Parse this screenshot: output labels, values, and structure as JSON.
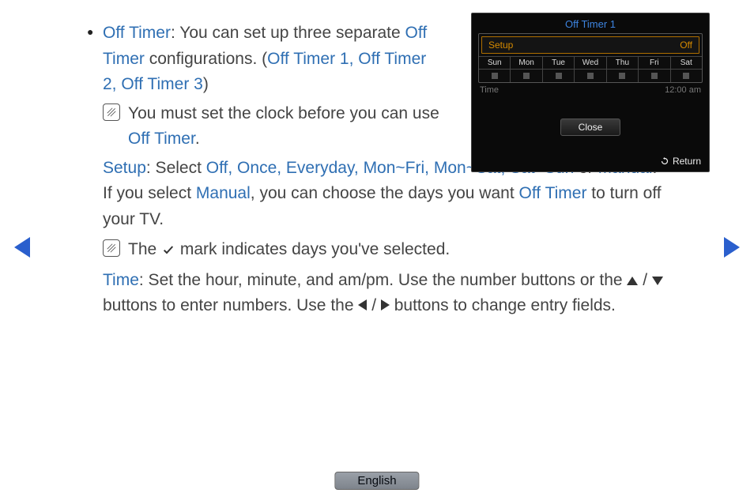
{
  "main": {
    "bullet1_k1": "Off Timer",
    "bullet1_txt1": ": You can set up three separate ",
    "bullet1_k2": "Off Timer",
    "bullet1_txt2": " configurations. (",
    "bullet1_k3": "Off Timer 1, Off Timer 2, Off Timer 3",
    "bullet1_txt3": ")",
    "note1_a": "You must set the clock before you can use ",
    "note1_k": "Off Timer",
    "note1_b": ".",
    "setup_k1": "Setup",
    "setup_txt1": ": Select ",
    "setup_k2": "Off, Once, Everyday, Mon~Fri, Mon~Sat, Sat~Sun",
    "setup_txt2": " or ",
    "setup_k3": "Manual",
    "setup_txt3": ". If you select ",
    "setup_k4": "Manual",
    "setup_txt4": ", you can choose the days you want ",
    "setup_k5": "Off Timer",
    "setup_txt5": " to turn off your TV.",
    "note2_a": "The ",
    "note2_b": " mark indicates days you've selected.",
    "time_k": "Time",
    "time_txt1": ": Set the hour, minute, and am/pm. Use the number buttons or the ",
    "time_txt2": " buttons to enter numbers. Use the ",
    "time_txt3": " buttons to change entry fields."
  },
  "osd": {
    "title": "Off Timer 1",
    "setup_label": "Setup",
    "setup_value": "Off",
    "days": [
      "Sun",
      "Mon",
      "Tue",
      "Wed",
      "Thu",
      "Fri",
      "Sat"
    ],
    "time_label": "Time",
    "time_value": "12:00 am",
    "close": "Close",
    "return": "Return"
  },
  "footer": {
    "language": "English"
  }
}
